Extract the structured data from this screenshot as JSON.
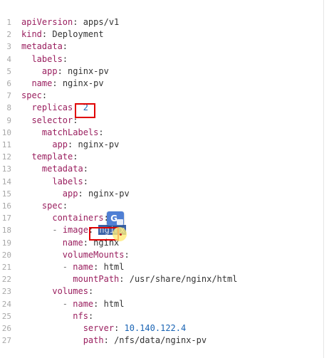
{
  "editor": {
    "lines": [
      {
        "n": "1",
        "indent": "",
        "key": "apiVersion",
        "sep": ": ",
        "value": "apps/v1",
        "vtype": "str"
      },
      {
        "n": "2",
        "indent": "",
        "key": "kind",
        "sep": ": ",
        "value": "Deployment",
        "vtype": "str"
      },
      {
        "n": "3",
        "indent": "",
        "key": "metadata",
        "sep": ":",
        "value": "",
        "vtype": "str"
      },
      {
        "n": "4",
        "indent": "  ",
        "key": "labels",
        "sep": ":",
        "value": "",
        "vtype": "str"
      },
      {
        "n": "5",
        "indent": "    ",
        "key": "app",
        "sep": ": ",
        "value": "nginx-pv",
        "vtype": "str"
      },
      {
        "n": "6",
        "indent": "  ",
        "key": "name",
        "sep": ": ",
        "value": "nginx-pv",
        "vtype": "str"
      },
      {
        "n": "7",
        "indent": "",
        "key": "spec",
        "sep": ":",
        "value": "",
        "vtype": "str"
      },
      {
        "n": "8",
        "indent": "  ",
        "key": "replicas",
        "sep": ": ",
        "value": "2",
        "vtype": "num"
      },
      {
        "n": "9",
        "indent": "  ",
        "key": "selector",
        "sep": ":",
        "value": "",
        "vtype": "str"
      },
      {
        "n": "10",
        "indent": "    ",
        "key": "matchLabels",
        "sep": ":",
        "value": "",
        "vtype": "str"
      },
      {
        "n": "11",
        "indent": "      ",
        "key": "app",
        "sep": ": ",
        "value": "nginx-pv",
        "vtype": "str"
      },
      {
        "n": "12",
        "indent": "  ",
        "key": "template",
        "sep": ":",
        "value": "",
        "vtype": "str"
      },
      {
        "n": "13",
        "indent": "    ",
        "key": "metadata",
        "sep": ":",
        "value": "",
        "vtype": "str"
      },
      {
        "n": "14",
        "indent": "      ",
        "key": "labels",
        "sep": ":",
        "value": "",
        "vtype": "str"
      },
      {
        "n": "15",
        "indent": "        ",
        "key": "app",
        "sep": ": ",
        "value": "nginx-pv",
        "vtype": "str"
      },
      {
        "n": "16",
        "indent": "    ",
        "key": "spec",
        "sep": ":",
        "value": "",
        "vtype": "str"
      },
      {
        "n": "17",
        "indent": "      ",
        "key": "containers",
        "sep": ":",
        "value": "",
        "vtype": "str"
      },
      {
        "n": "18",
        "indent": "      ",
        "dash": "- ",
        "key": "image",
        "sep": ": ",
        "value": "nginx",
        "vtype": "selected"
      },
      {
        "n": "19",
        "indent": "        ",
        "key": "name",
        "sep": ": ",
        "value": "nginx",
        "vtype": "str"
      },
      {
        "n": "20",
        "indent": "        ",
        "key": "volumeMounts",
        "sep": ":",
        "value": "",
        "vtype": "str"
      },
      {
        "n": "21",
        "indent": "        ",
        "dash": "- ",
        "key": "name",
        "sep": ": ",
        "value": "html",
        "vtype": "str"
      },
      {
        "n": "22",
        "indent": "          ",
        "key": "mountPath",
        "sep": ": ",
        "value": "/usr/share/nginx/html",
        "vtype": "str"
      },
      {
        "n": "23",
        "indent": "      ",
        "key": "volumes",
        "sep": ":",
        "value": "",
        "vtype": "str"
      },
      {
        "n": "24",
        "indent": "        ",
        "dash": "- ",
        "key": "name",
        "sep": ": ",
        "value": "html",
        "vtype": "str"
      },
      {
        "n": "25",
        "indent": "          ",
        "key": "nfs",
        "sep": ":",
        "value": "",
        "vtype": "str"
      },
      {
        "n": "26",
        "indent": "            ",
        "key": "server",
        "sep": ": ",
        "value": "10.140.122.4",
        "vtype": "num"
      },
      {
        "n": "27",
        "indent": "            ",
        "key": "path",
        "sep": ": ",
        "value": "/nfs/data/nginx-pv",
        "vtype": "str"
      }
    ]
  },
  "overlay": {
    "translate_icon": "google-translate-icon",
    "translate_glyph": "G"
  },
  "colors": {
    "key": "#9a1f5f",
    "number": "#1a64b4",
    "highlight_border": "#e00000",
    "selection": "#3b63a8"
  }
}
